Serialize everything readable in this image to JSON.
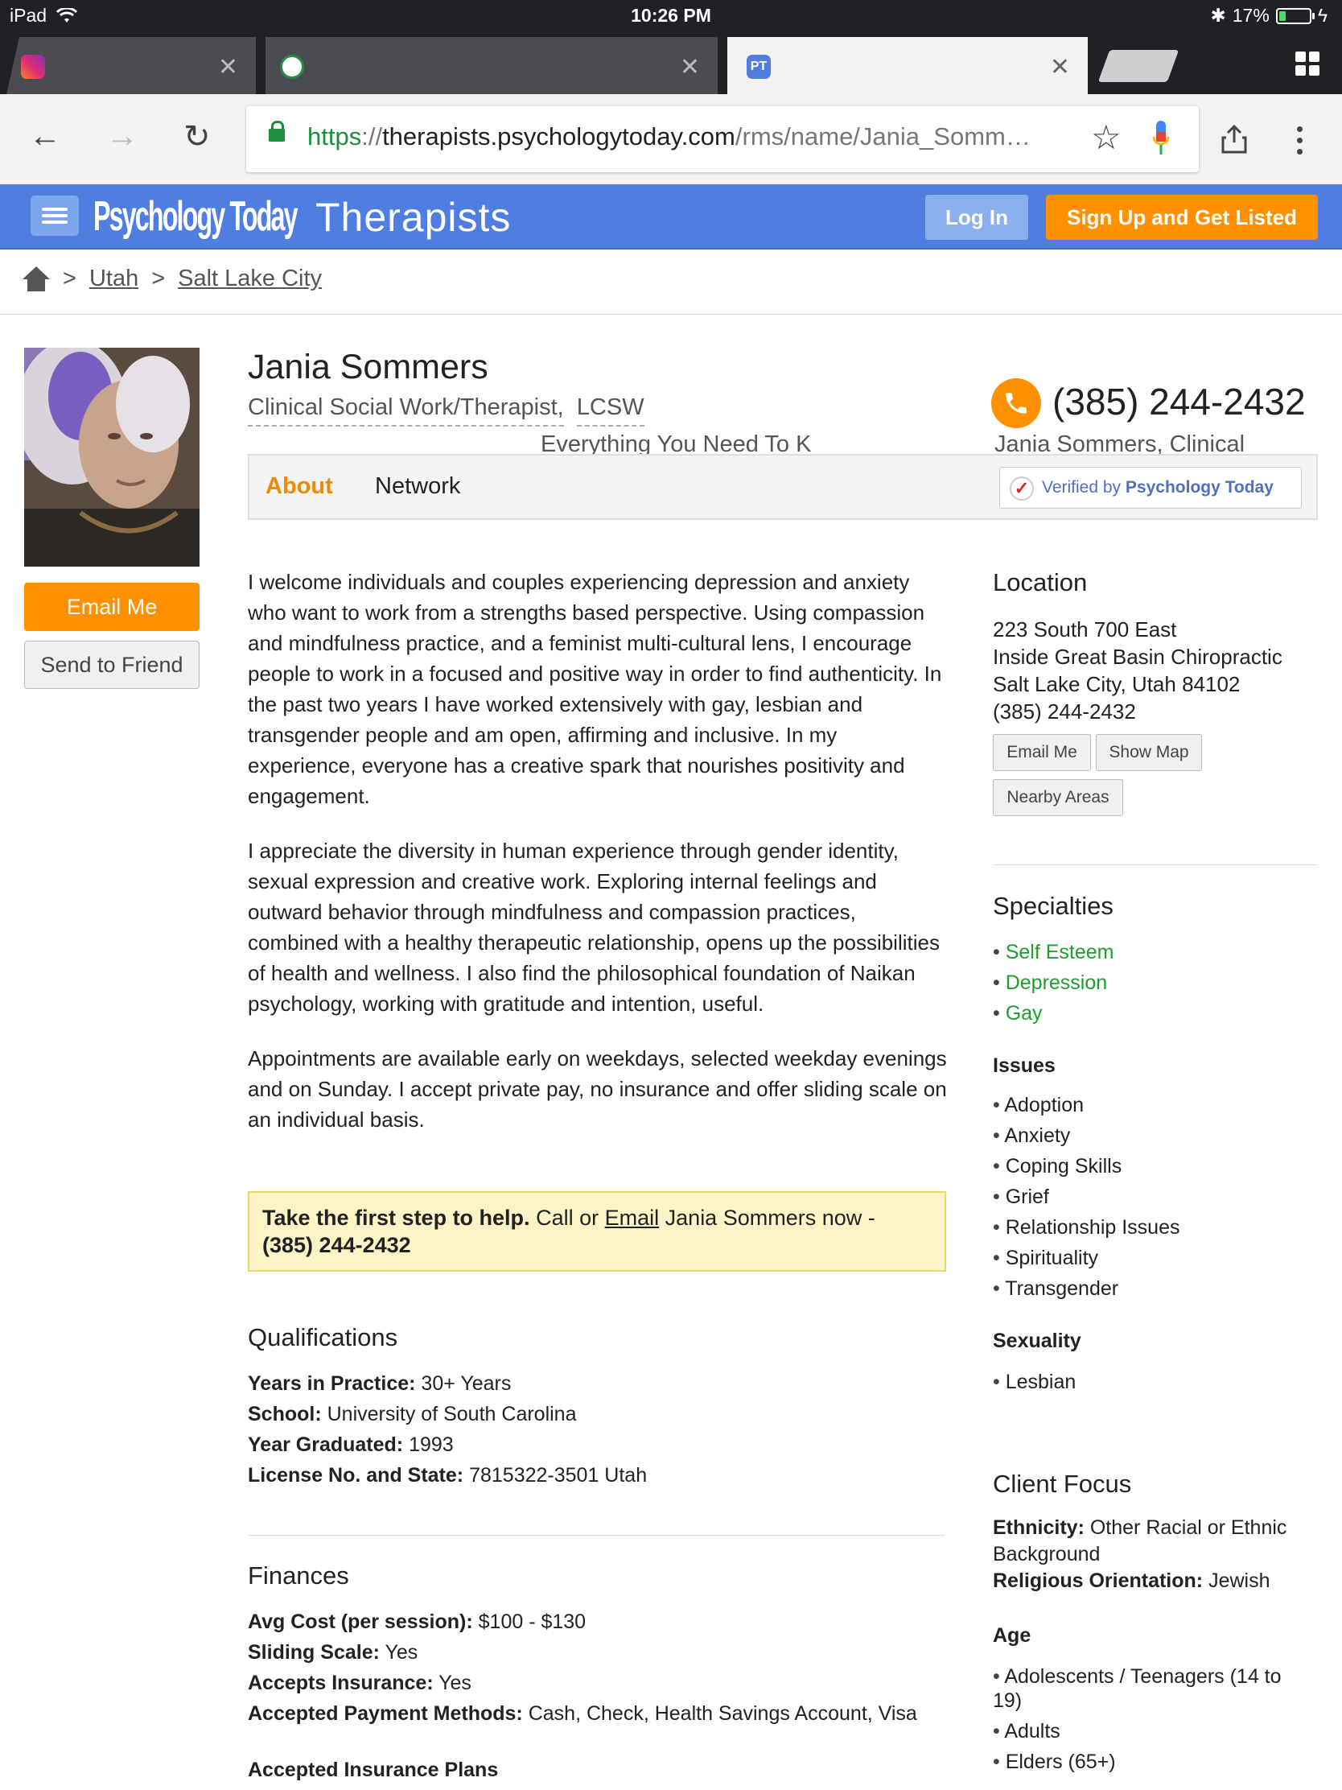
{
  "status_bar": {
    "device": "iPad",
    "time": "10:26 PM",
    "battery": "17%"
  },
  "browser": {
    "tabs": [
      {
        "title": "Instagram",
        "active": false
      },
      {
        "title": "Everything You Need To K",
        "active": false
      },
      {
        "title": "Jania Sommers, Clinical",
        "active": true
      }
    ],
    "url": {
      "scheme": "https",
      "sep": "://",
      "host": "therapists.psychologytoday.com",
      "path": "/rms/name/Jania_Somm…"
    }
  },
  "site": {
    "logo": "Psychology Today",
    "section": "Therapists",
    "login_label": "Log In",
    "signup_label": "Sign Up and Get Listed"
  },
  "breadcrumb": {
    "sep": ">",
    "items": [
      "Utah",
      "Salt Lake City"
    ]
  },
  "profile": {
    "name": "Jania Sommers",
    "title_main": "Clinical Social Work/Therapist,",
    "title_suffix": "LCSW",
    "phone": "(385) 244-2432",
    "email_label": "Email Me",
    "send_label": "Send to Friend"
  },
  "profile_tabs": {
    "about": "About",
    "network": "Network",
    "verified_prefix": "Verified by",
    "verified_brand": "Psychology Today"
  },
  "about": {
    "paragraphs": [
      "I welcome individuals and couples experiencing depression and anxiety who want to work from a strengths based perspective. Using compassion and mindfulness practice, and a feminist multi-cultural lens, I encourage people to work in a focused and positive way in order to find authenticity. In the past two years I have worked extensively with gay, lesbian and transgender people and am open, affirming and inclusive. In my experience, everyone has a creative spark that nourishes positivity and engagement.",
      "I appreciate the diversity in human experience through gender identity, sexual expression and creative work. Exploring internal feelings and outward behavior through mindfulness and compassion practices, combined with a healthy therapeutic relationship, opens up the possibilities of health and wellness. I also find the philosophical foundation of Naikan psychology, working with gratitude and intention, useful.",
      "Appointments are available early on weekdays, selected weekday evenings and on Sunday. I accept private pay, no insurance and offer sliding scale on an individual basis."
    ],
    "cta_bold": "Take the first step to help.",
    "cta_call": "Call or",
    "cta_email": "Email",
    "cta_rest": "Jania Sommers now -",
    "cta_phone": "(385) 244-2432"
  },
  "qualifications": {
    "heading": "Qualifications",
    "rows": [
      {
        "label": "Years in Practice:",
        "value": "30+ Years"
      },
      {
        "label": "School:",
        "value": "University of South Carolina"
      },
      {
        "label": "Year Graduated:",
        "value": "1993"
      },
      {
        "label": "License No. and State:",
        "value": "7815322-3501 Utah"
      }
    ]
  },
  "finances": {
    "heading": "Finances",
    "rows": [
      {
        "label": "Avg Cost (per session):",
        "value": "$100 - $130"
      },
      {
        "label": "Sliding Scale:",
        "value": "Yes"
      },
      {
        "label": "Accepts Insurance:",
        "value": "Yes"
      },
      {
        "label": "Accepted Payment Methods:",
        "value": "Cash, Check, Health Savings Account, Visa"
      }
    ],
    "insurance_heading": "Accepted Insurance Plans"
  },
  "location": {
    "heading": "Location",
    "lines": [
      "223 South 700 East",
      "Inside Great Basin Chiropractic",
      "Salt Lake City, Utah 84102",
      "(385) 244-2432"
    ],
    "email_btn": "Email Me",
    "map_btn": "Show Map",
    "nearby_btn": "Nearby Areas"
  },
  "specialties": {
    "heading": "Specialties",
    "items": [
      "Self Esteem",
      "Depression",
      "Gay"
    ],
    "issues_heading": "Issues",
    "issues": [
      "Adoption",
      "Anxiety",
      "Coping Skills",
      "Grief",
      "Relationship Issues",
      "Spirituality",
      "Transgender"
    ],
    "sexuality_heading": "Sexuality",
    "sexuality": [
      "Lesbian"
    ]
  },
  "client_focus": {
    "heading": "Client Focus",
    "ethnicity_label": "Ethnicity:",
    "ethnicity_value": "Other Racial or Ethnic Background",
    "religion_label": "Religious Orientation:",
    "religion_value": "Jewish",
    "age_heading": "Age",
    "ages": [
      "Adolescents / Teenagers (14 to 19)",
      "Adults",
      "Elders (65+)"
    ]
  },
  "colors": {
    "brand_blue": "#4f7ee0",
    "accent_orange": "#ff9000",
    "specialty_green": "#1e9e2c",
    "cta_bg": "#fcf4c6"
  },
  "icons": [
    "wifi-icon",
    "bluetooth-icon",
    "battery-icon",
    "back-icon",
    "forward-icon",
    "reload-icon",
    "lock-icon",
    "star-icon",
    "mic-icon",
    "share-icon",
    "more-icon",
    "menu-icon",
    "home-icon",
    "phone-icon",
    "check-icon"
  ]
}
